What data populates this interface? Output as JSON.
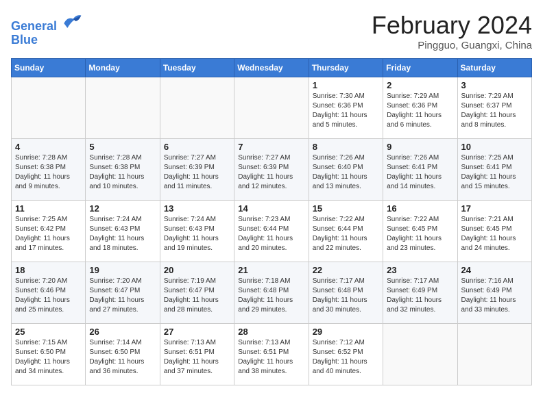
{
  "header": {
    "logo_line1": "General",
    "logo_line2": "Blue",
    "month_title": "February 2024",
    "location": "Pingguo, Guangxi, China"
  },
  "days_of_week": [
    "Sunday",
    "Monday",
    "Tuesday",
    "Wednesday",
    "Thursday",
    "Friday",
    "Saturday"
  ],
  "weeks": [
    [
      {
        "day": "",
        "info": ""
      },
      {
        "day": "",
        "info": ""
      },
      {
        "day": "",
        "info": ""
      },
      {
        "day": "",
        "info": ""
      },
      {
        "day": "1",
        "info": "Sunrise: 7:30 AM\nSunset: 6:36 PM\nDaylight: 11 hours and 5 minutes."
      },
      {
        "day": "2",
        "info": "Sunrise: 7:29 AM\nSunset: 6:36 PM\nDaylight: 11 hours and 6 minutes."
      },
      {
        "day": "3",
        "info": "Sunrise: 7:29 AM\nSunset: 6:37 PM\nDaylight: 11 hours and 8 minutes."
      }
    ],
    [
      {
        "day": "4",
        "info": "Sunrise: 7:28 AM\nSunset: 6:38 PM\nDaylight: 11 hours and 9 minutes."
      },
      {
        "day": "5",
        "info": "Sunrise: 7:28 AM\nSunset: 6:38 PM\nDaylight: 11 hours and 10 minutes."
      },
      {
        "day": "6",
        "info": "Sunrise: 7:27 AM\nSunset: 6:39 PM\nDaylight: 11 hours and 11 minutes."
      },
      {
        "day": "7",
        "info": "Sunrise: 7:27 AM\nSunset: 6:39 PM\nDaylight: 11 hours and 12 minutes."
      },
      {
        "day": "8",
        "info": "Sunrise: 7:26 AM\nSunset: 6:40 PM\nDaylight: 11 hours and 13 minutes."
      },
      {
        "day": "9",
        "info": "Sunrise: 7:26 AM\nSunset: 6:41 PM\nDaylight: 11 hours and 14 minutes."
      },
      {
        "day": "10",
        "info": "Sunrise: 7:25 AM\nSunset: 6:41 PM\nDaylight: 11 hours and 15 minutes."
      }
    ],
    [
      {
        "day": "11",
        "info": "Sunrise: 7:25 AM\nSunset: 6:42 PM\nDaylight: 11 hours and 17 minutes."
      },
      {
        "day": "12",
        "info": "Sunrise: 7:24 AM\nSunset: 6:43 PM\nDaylight: 11 hours and 18 minutes."
      },
      {
        "day": "13",
        "info": "Sunrise: 7:24 AM\nSunset: 6:43 PM\nDaylight: 11 hours and 19 minutes."
      },
      {
        "day": "14",
        "info": "Sunrise: 7:23 AM\nSunset: 6:44 PM\nDaylight: 11 hours and 20 minutes."
      },
      {
        "day": "15",
        "info": "Sunrise: 7:22 AM\nSunset: 6:44 PM\nDaylight: 11 hours and 22 minutes."
      },
      {
        "day": "16",
        "info": "Sunrise: 7:22 AM\nSunset: 6:45 PM\nDaylight: 11 hours and 23 minutes."
      },
      {
        "day": "17",
        "info": "Sunrise: 7:21 AM\nSunset: 6:45 PM\nDaylight: 11 hours and 24 minutes."
      }
    ],
    [
      {
        "day": "18",
        "info": "Sunrise: 7:20 AM\nSunset: 6:46 PM\nDaylight: 11 hours and 25 minutes."
      },
      {
        "day": "19",
        "info": "Sunrise: 7:20 AM\nSunset: 6:47 PM\nDaylight: 11 hours and 27 minutes."
      },
      {
        "day": "20",
        "info": "Sunrise: 7:19 AM\nSunset: 6:47 PM\nDaylight: 11 hours and 28 minutes."
      },
      {
        "day": "21",
        "info": "Sunrise: 7:18 AM\nSunset: 6:48 PM\nDaylight: 11 hours and 29 minutes."
      },
      {
        "day": "22",
        "info": "Sunrise: 7:17 AM\nSunset: 6:48 PM\nDaylight: 11 hours and 30 minutes."
      },
      {
        "day": "23",
        "info": "Sunrise: 7:17 AM\nSunset: 6:49 PM\nDaylight: 11 hours and 32 minutes."
      },
      {
        "day": "24",
        "info": "Sunrise: 7:16 AM\nSunset: 6:49 PM\nDaylight: 11 hours and 33 minutes."
      }
    ],
    [
      {
        "day": "25",
        "info": "Sunrise: 7:15 AM\nSunset: 6:50 PM\nDaylight: 11 hours and 34 minutes."
      },
      {
        "day": "26",
        "info": "Sunrise: 7:14 AM\nSunset: 6:50 PM\nDaylight: 11 hours and 36 minutes."
      },
      {
        "day": "27",
        "info": "Sunrise: 7:13 AM\nSunset: 6:51 PM\nDaylight: 11 hours and 37 minutes."
      },
      {
        "day": "28",
        "info": "Sunrise: 7:13 AM\nSunset: 6:51 PM\nDaylight: 11 hours and 38 minutes."
      },
      {
        "day": "29",
        "info": "Sunrise: 7:12 AM\nSunset: 6:52 PM\nDaylight: 11 hours and 40 minutes."
      },
      {
        "day": "",
        "info": ""
      },
      {
        "day": "",
        "info": ""
      }
    ]
  ]
}
